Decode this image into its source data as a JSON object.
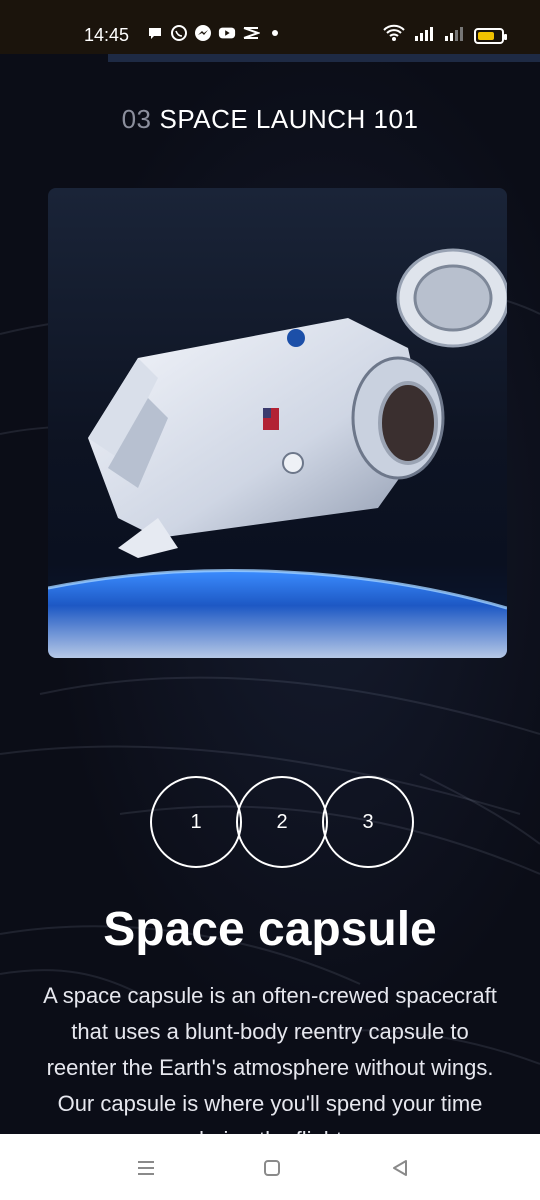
{
  "status_bar": {
    "time": "14:45",
    "notification_icons": [
      "chat-bubble-icon",
      "whatsapp-icon",
      "messenger-icon",
      "youtube-icon",
      "capcut-icon",
      "dot-icon"
    ],
    "battery_color": "#f2c200"
  },
  "page": {
    "number": "03",
    "heading": "SPACE LAUNCH 101",
    "image_subject": "spacecraft",
    "pager": [
      "1",
      "2",
      "3"
    ],
    "title": "Space capsule",
    "description": "A space capsule is an often-crewed spacecraft that uses a blunt-body reentry capsule to reenter the Earth's atmosphere without wings. Our capsule is where you'll spend your time during the flight."
  },
  "colors": {
    "background": "#0b0d17",
    "muted_text": "#8b8e9c",
    "accent": "#1e2a44"
  }
}
